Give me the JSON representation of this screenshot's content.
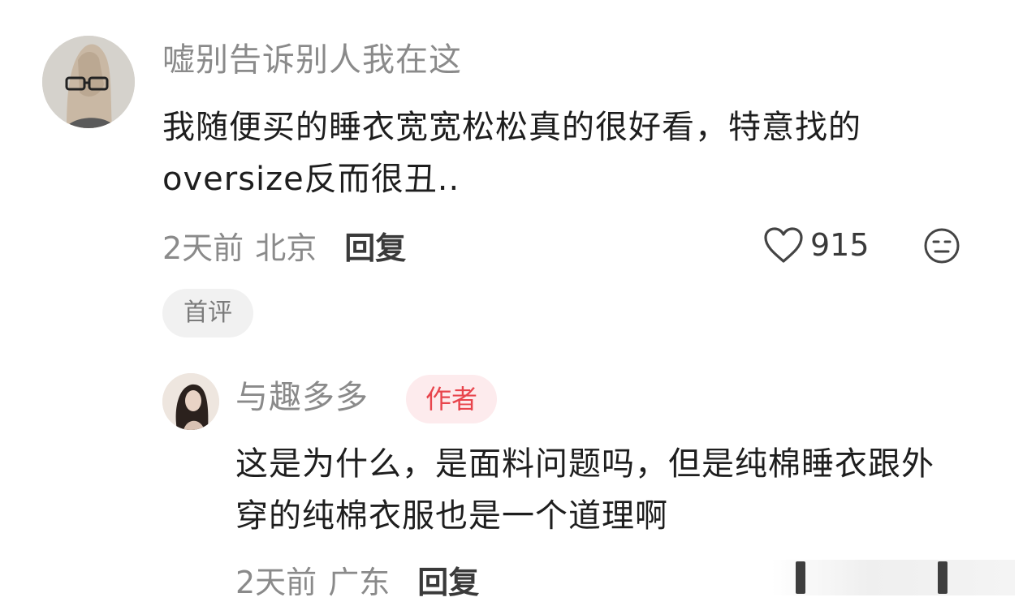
{
  "comment": {
    "username": "嘘别告诉别人我在这",
    "text": "我随便买的睡衣宽宽松松真的很好看，特意找的oversize反而很丑..",
    "time": "2天前",
    "location": "北京",
    "reply_label": "回复",
    "like_count": "915",
    "like_icon": "heart-outline-icon",
    "dislike_icon": "meh-face-icon",
    "badge": "首评"
  },
  "reply": {
    "username": "与趣多多",
    "author_badge": "作者",
    "text": "这是为什么，是面料问题吗，但是纯棉睡衣跟外穿的纯棉衣服也是一个道理啊",
    "time": "2天前",
    "location": "广东",
    "reply_label": "回复"
  },
  "colors": {
    "author_badge_text": "#e8454d",
    "author_badge_bg": "#fdebed",
    "meta_text": "#8a8a8a",
    "body_text": "#1e1e1e"
  }
}
